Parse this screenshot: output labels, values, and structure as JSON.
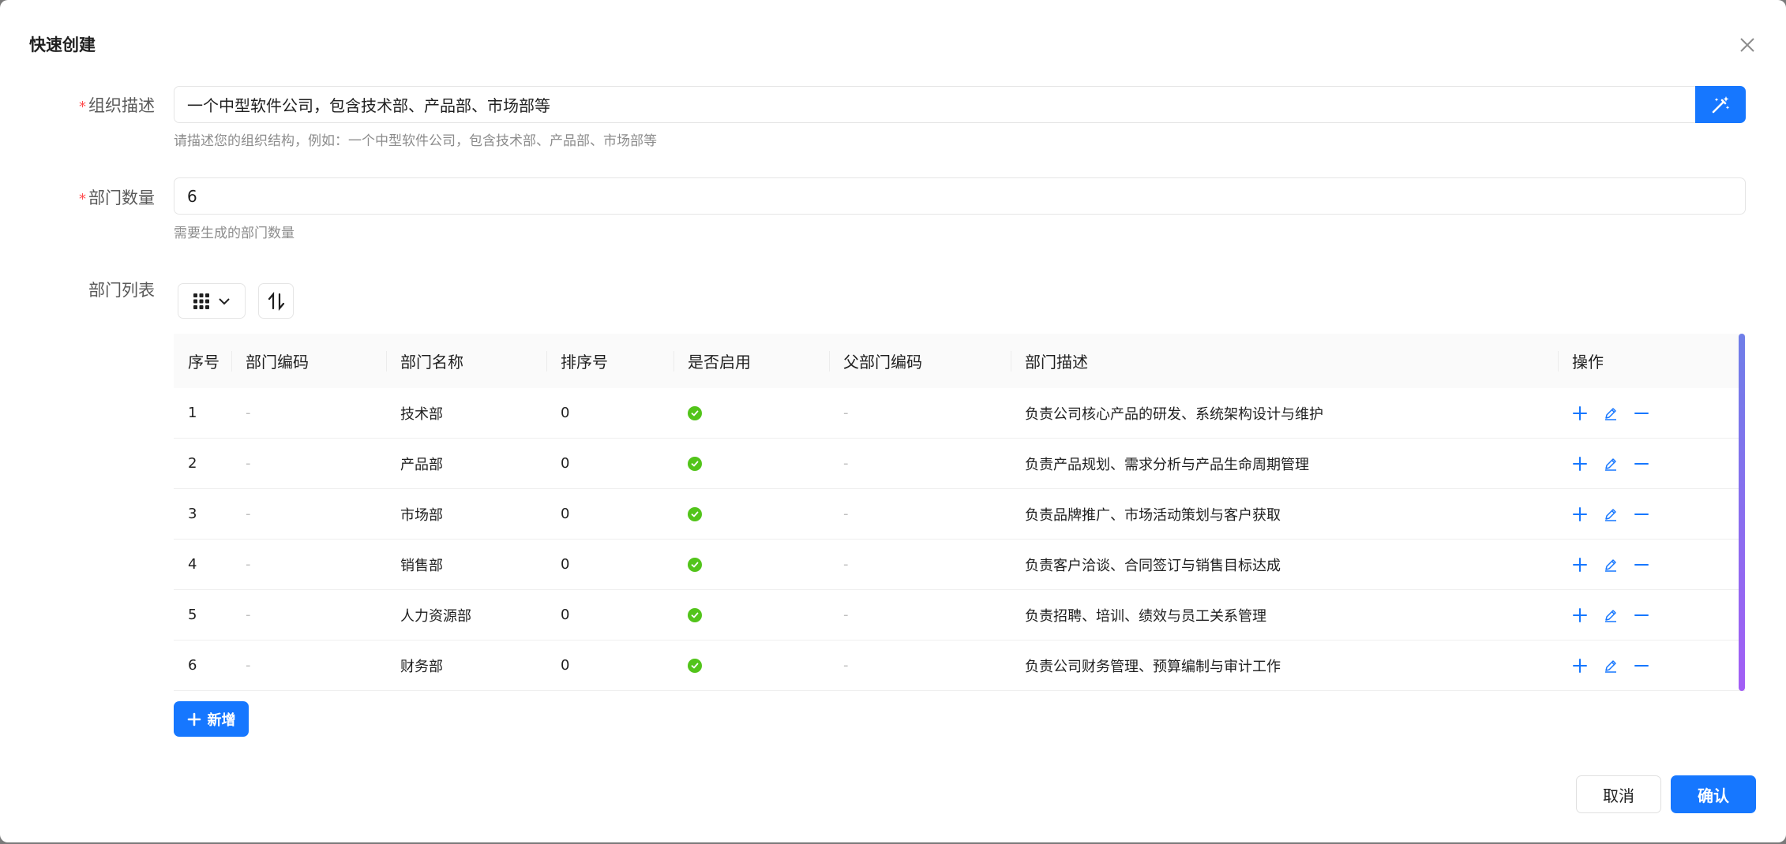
{
  "dialog": {
    "title": "快速创建",
    "close_icon": "close-icon"
  },
  "org_description": {
    "required_mark": "*",
    "label": "组织描述",
    "value": "一个中型软件公司，包含技术部、产品部、市场部等",
    "help": "请描述您的组织结构，例如：一个中型软件公司，包含技术部、产品部、市场部等",
    "action_icon": "magic-wand-icon"
  },
  "dept_count": {
    "required_mark": "*",
    "label": "部门数量",
    "value": "6",
    "help": "需要生成的部门数量"
  },
  "dept_list": {
    "label": "部门列表",
    "toolbar": {
      "column_settings_icon": "grid-icon",
      "dropdown_icon": "chevron-down-icon",
      "sort_icon": "sort-icon"
    },
    "columns": [
      "序号",
      "部门编码",
      "部门名称",
      "排序号",
      "是否启用",
      "父部门编码",
      "部门描述",
      "操作"
    ],
    "rows": [
      {
        "index": "1",
        "code": "-",
        "name": "技术部",
        "sort": "0",
        "enabled": true,
        "parent": "-",
        "desc": "负责公司核心产品的研发、系统架构设计与维护"
      },
      {
        "index": "2",
        "code": "-",
        "name": "产品部",
        "sort": "0",
        "enabled": true,
        "parent": "-",
        "desc": "负责产品规划、需求分析与产品生命周期管理"
      },
      {
        "index": "3",
        "code": "-",
        "name": "市场部",
        "sort": "0",
        "enabled": true,
        "parent": "-",
        "desc": "负责品牌推广、市场活动策划与客户获取"
      },
      {
        "index": "4",
        "code": "-",
        "name": "销售部",
        "sort": "0",
        "enabled": true,
        "parent": "-",
        "desc": "负责客户洽谈、合同签订与销售目标达成"
      },
      {
        "index": "5",
        "code": "-",
        "name": "人力资源部",
        "sort": "0",
        "enabled": true,
        "parent": "-",
        "desc": "负责招聘、培训、绩效与员工关系管理"
      },
      {
        "index": "6",
        "code": "-",
        "name": "财务部",
        "sort": "0",
        "enabled": true,
        "parent": "-",
        "desc": "负责公司财务管理、预算编制与审计工作"
      }
    ],
    "row_action_icons": [
      "plus-icon",
      "edit-icon",
      "minus-icon"
    ],
    "add_label": "新增"
  },
  "footer": {
    "cancel_label": "取消",
    "confirm_label": "确认"
  },
  "colors": {
    "primary": "#1677ff",
    "success": "#52c41a",
    "required": "#ff4d4f"
  }
}
